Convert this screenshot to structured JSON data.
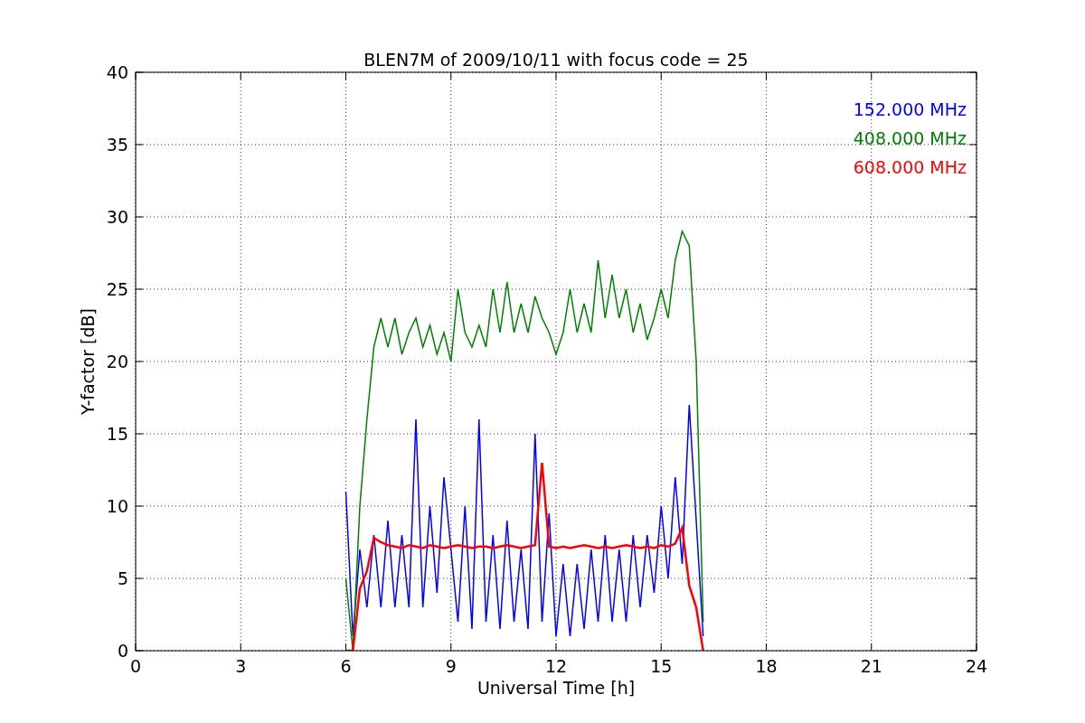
{
  "chart_data": {
    "type": "line",
    "title": "BLEN7M of 2009/10/11 with focus code = 25",
    "xlabel": "Universal Time [h]",
    "ylabel": "Y-factor [dB]",
    "x": [
      6.0,
      6.2,
      6.4,
      6.6,
      6.8,
      7.0,
      7.2,
      7.4,
      7.6,
      7.8,
      8.0,
      8.2,
      8.4,
      8.6,
      8.8,
      9.0,
      9.2,
      9.4,
      9.6,
      9.8,
      10.0,
      10.2,
      10.4,
      10.6,
      10.8,
      11.0,
      11.2,
      11.4,
      11.6,
      11.8,
      12.0,
      12.2,
      12.4,
      12.6,
      12.8,
      13.0,
      13.2,
      13.4,
      13.6,
      13.8,
      14.0,
      14.2,
      14.4,
      14.6,
      14.8,
      15.0,
      15.2,
      15.4,
      15.6,
      15.8,
      16.0,
      16.2
    ],
    "series": [
      {
        "name": "152.000 MHz",
        "color": "#0000ff",
        "values": [
          11,
          1,
          7,
          3,
          8,
          3,
          9,
          3,
          8,
          3,
          16,
          3,
          10,
          4,
          12,
          7,
          2,
          10,
          1.5,
          16,
          2,
          8,
          1.5,
          9,
          2,
          7,
          1.5,
          15,
          2,
          9.5,
          1,
          6,
          1,
          6,
          1.5,
          7,
          2,
          8,
          2,
          7,
          2,
          8,
          3,
          8,
          4,
          10,
          5,
          12,
          6,
          17,
          9,
          1
        ]
      },
      {
        "name": "408.000 MHz",
        "color": "#008000",
        "values": [
          5,
          0,
          10,
          16,
          21,
          23,
          21,
          23,
          20.5,
          22,
          23,
          21,
          22.5,
          20.5,
          22,
          20,
          25,
          22,
          21,
          22.5,
          21,
          25,
          22,
          25.5,
          22,
          24,
          22,
          24.5,
          23,
          22,
          20.5,
          22,
          25,
          22,
          24,
          22,
          27,
          23,
          26,
          23,
          25,
          22,
          24,
          21.5,
          23,
          25,
          23,
          27,
          29,
          28,
          20,
          2
        ]
      },
      {
        "name": "608.000 MHz",
        "color": "#ff0000",
        "values": [
          0,
          0,
          4.3,
          5.5,
          7.8,
          7.5,
          7.3,
          7.2,
          7.1,
          7.3,
          7.2,
          7.1,
          7.3,
          7.2,
          7.1,
          7.2,
          7.3,
          7.2,
          7.1,
          7.2,
          7.2,
          7.1,
          7.2,
          7.3,
          7.2,
          7.1,
          7.2,
          7.3,
          13,
          7.2,
          7.1,
          7.2,
          7.1,
          7.2,
          7.3,
          7.2,
          7.1,
          7.2,
          7.1,
          7.2,
          7.3,
          7.2,
          7.1,
          7.2,
          7.1,
          7.3,
          7.2,
          7.4,
          8.5,
          4.5,
          3,
          0
        ]
      }
    ],
    "xlim": [
      0,
      24
    ],
    "ylim": [
      0,
      40
    ],
    "xticks": [
      0,
      3,
      6,
      9,
      12,
      15,
      18,
      21,
      24
    ],
    "yticks": [
      0,
      5,
      10,
      15,
      20,
      25,
      30,
      35,
      40
    ],
    "grid": true
  }
}
